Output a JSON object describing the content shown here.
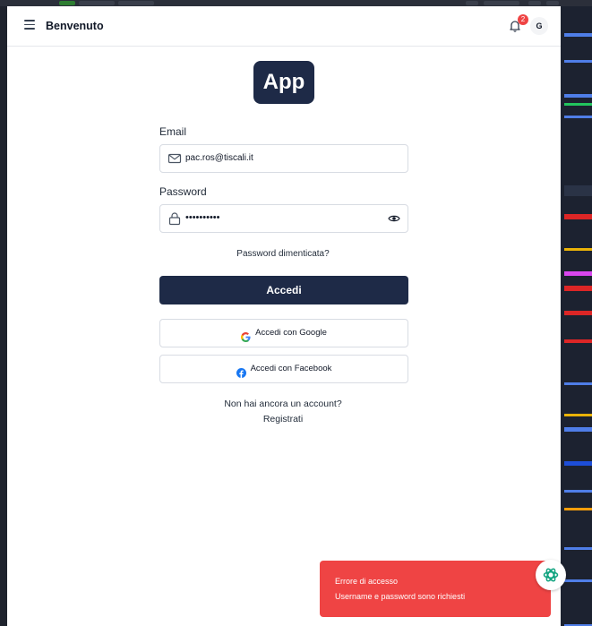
{
  "header": {
    "title": "Benvenuto",
    "notification_count": "2",
    "avatar_initial": "G"
  },
  "logo": {
    "text": "App"
  },
  "form": {
    "email_label": "Email",
    "email_value": "pac.ros@tiscali.it",
    "password_label": "Password",
    "password_value": "••••••••••",
    "forgot_link": "Password dimenticata?",
    "submit_label": "Accedi",
    "google_label": "Accedi con Google",
    "facebook_label": "Accedi con Facebook",
    "no_account_text": "Non hai ancora un account?",
    "register_link": "Registrati"
  },
  "toast": {
    "title": "Errore di accesso",
    "message": "Username e password sono richiesti"
  },
  "colors": {
    "primary": "#1e2a47",
    "toast_bg": "#ef4444",
    "badge": "#ef4444",
    "facebook": "#1877f2"
  },
  "icons": [
    "menu-icon",
    "bell-icon",
    "mail-icon",
    "lock-icon",
    "eye-icon",
    "google-icon",
    "facebook-icon",
    "chatgpt-icon"
  ]
}
